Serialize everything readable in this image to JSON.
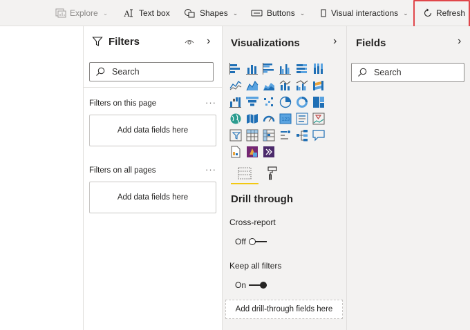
{
  "ribbon": {
    "explore": "Explore",
    "text_box": "Text box",
    "shapes": "Shapes",
    "buttons": "Buttons",
    "visual_interactions": "Visual interactions",
    "refresh": "Refresh",
    "highlight_color": "#e0464a"
  },
  "filters": {
    "title": "Filters",
    "search_placeholder": "Search",
    "on_this_page": "Filters on this page",
    "on_all_pages": "Filters on all pages",
    "more": "···",
    "add_fields": "Add data fields here"
  },
  "visualizations": {
    "title": "Visualizations",
    "icons": [
      "stacked-bar-chart-icon",
      "stacked-column-chart-icon",
      "clustered-bar-chart-icon",
      "clustered-column-chart-icon",
      "100-stacked-bar-chart-icon",
      "100-stacked-column-chart-icon",
      "line-chart-icon",
      "area-chart-icon",
      "stacked-area-chart-icon",
      "line-and-stacked-column-chart-icon",
      "line-and-clustered-column-chart-icon",
      "ribbon-chart-icon",
      "waterfall-chart-icon",
      "funnel-chart-icon",
      "scatter-chart-icon",
      "pie-chart-icon",
      "donut-chart-icon",
      "treemap-icon",
      "map-icon",
      "filled-map-icon",
      "gauge-icon",
      "card-icon",
      "multi-row-card-icon",
      "kpi-icon",
      "slicer-icon",
      "table-icon",
      "matrix-icon",
      "key-influencers-icon",
      "decomposition-tree-icon",
      "qa-icon",
      "paginated-report-icon",
      "power-apps-icon",
      "power-automate-icon"
    ],
    "drill_through": "Drill through",
    "cross_report": "Cross-report",
    "cross_report_state": "Off",
    "keep_all_filters": "Keep all filters",
    "keep_all_filters_state": "On",
    "add_drill_fields": "Add drill-through fields here",
    "accent": "#f2c811"
  },
  "fields": {
    "title": "Fields",
    "search_placeholder": "Search"
  }
}
